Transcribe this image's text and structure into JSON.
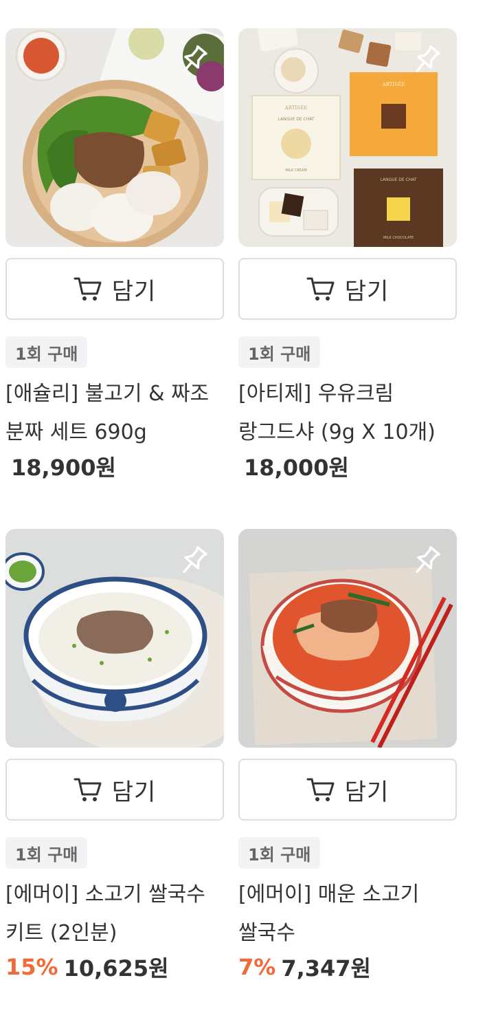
{
  "products": [
    {
      "name": "[애슐리] 불고기 & 짜조 분짜 세트 690g",
      "badge": "1회 구매",
      "cart_label": "담기",
      "discount": "",
      "price": "18,900원"
    },
    {
      "name": "[아티제] 우유크림 랑그드샤 (9g X 10개)",
      "badge": "1회 구매",
      "cart_label": "담기",
      "discount": "",
      "price": "18,000원"
    },
    {
      "name": "[에머이] 소고기 쌀국수 키트 (2인분)",
      "badge": "1회 구매",
      "cart_label": "담기",
      "discount": "15%",
      "price": "10,625원"
    },
    {
      "name": "[에머이] 매운 소고기 쌀국수",
      "badge": "1회 구매",
      "cart_label": "담기",
      "discount": "7%",
      "price": "7,347원"
    }
  ],
  "images": {
    "p0": {
      "package_brand": "",
      "package_title": ""
    },
    "p1": {
      "package_brand": "ARTISÉE",
      "package_title": "LANGUE DE CHAT",
      "package_sub_1": "MILK CREAM",
      "package_sub_2": "MILK CHOCOLATE"
    }
  },
  "icons": {
    "pin": "pin-icon",
    "cart": "cart-icon"
  },
  "colors": {
    "discount": "#f06a3a",
    "badge_bg": "#f2f3f5",
    "border": "#dddddd"
  }
}
